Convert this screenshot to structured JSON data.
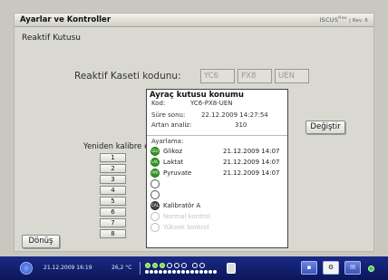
{
  "window": {
    "title": "Ayarlar ve Kontroller",
    "brand": "ISCUS",
    "brand_sup": "flex",
    "brand_rev": "| Rev. 6"
  },
  "section_title": "Reaktif Kutusu",
  "cassette": {
    "label": "Reaktif Kaseti kodunu:",
    "codes": [
      "YC6",
      "PX8",
      "UEN"
    ]
  },
  "recalibrate": {
    "label": "Yeniden kalibre et",
    "buttons": [
      "1",
      "2",
      "3",
      "4",
      "5",
      "6",
      "7",
      "8"
    ]
  },
  "info": {
    "title": "Ayraç kutusu konumu",
    "rows": [
      {
        "label": "Kod:",
        "value": "YC6-PX8-UEN"
      },
      {
        "label": "Süre sonu:",
        "value": "22.12.2009 14:27:54"
      },
      {
        "label": "Artan analiz:",
        "value": "310"
      }
    ],
    "adjustments_label": "Ayarlama:",
    "reagents": [
      {
        "name": "Glikoz",
        "date": "21.12.2009 14:07",
        "state": "green",
        "badge": "GLU"
      },
      {
        "name": "Laktat",
        "date": "21.12.2009 14:07",
        "state": "green",
        "badge": "LAC"
      },
      {
        "name": "Pyruvate",
        "date": "21.12.2009 14:07",
        "state": "green",
        "badge": "PYR"
      },
      {
        "name": "",
        "date": "",
        "state": "empty",
        "badge": ""
      },
      {
        "name": "",
        "date": "",
        "state": "empty",
        "badge": ""
      },
      {
        "name": "Kalibratör A",
        "date": "",
        "state": "dark",
        "badge": "CAL"
      },
      {
        "name": "Normal kontrol",
        "date": "",
        "state": "faint",
        "badge": ""
      },
      {
        "name": "Yüksek kontrol",
        "date": "",
        "state": "faint",
        "badge": ""
      }
    ]
  },
  "buttons": {
    "change": "Değiştir",
    "back": "Dönüş"
  },
  "taskbar": {
    "datetime": "21.12.2009 16:19",
    "temperature": "26,2 °C",
    "sample_badges": [
      "GLU",
      "LAC",
      "PYR"
    ]
  }
}
